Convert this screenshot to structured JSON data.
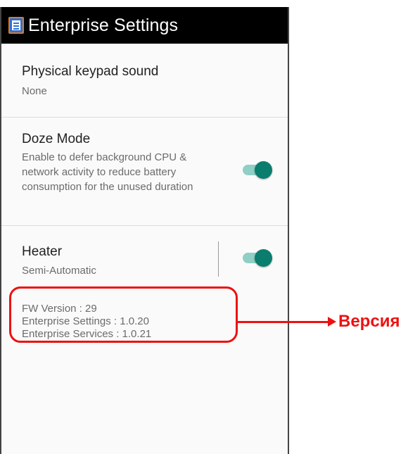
{
  "app": {
    "title": "Enterprise Settings",
    "icon": "enterprise-settings-app-icon"
  },
  "settings": [
    {
      "title": "Physical keypad sound",
      "summary": "None"
    },
    {
      "title": "Doze Mode",
      "summary": "Enable to defer background CPU & network activity to reduce battery consumption for the unused duration",
      "toggle_on": true
    },
    {
      "title": "Heater",
      "summary": "Semi-Automatic",
      "toggle_on": true
    }
  ],
  "versions": [
    "FW Version : 29",
    "Enterprise Settings : 1.0.20",
    "Enterprise Services : 1.0.21"
  ],
  "annotation": {
    "label": "Версия",
    "color": "#ee1111"
  },
  "colors": {
    "appbar": "#000000",
    "switch_thumb": "#0a7d6e",
    "switch_track": "#8fcfc5"
  }
}
